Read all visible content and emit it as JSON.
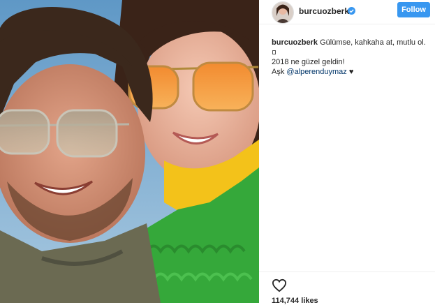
{
  "post": {
    "username": "burcuozberk",
    "follow_label": "Follow",
    "caption": {
      "username": "burcuozberk",
      "text_line1": "Gülümse, kahkaha at, mutlu ol.",
      "text_line3": "2018 ne güzel geldin!",
      "text_line4_prefix": "Aşk ",
      "mention": "@alperenduymaz",
      "heart_symbol": "♥"
    },
    "likes": "114,744 likes"
  },
  "icons": [
    "avatar",
    "verified-badge-icon",
    "heart-icon",
    "glyph-icon"
  ],
  "colors": {
    "follow_button": "#3897f0",
    "mention": "#003569",
    "sky": "#6fa6cf",
    "coat": "#35a83a",
    "scarf": "#f3c21a",
    "lens": "#f59a3c"
  }
}
